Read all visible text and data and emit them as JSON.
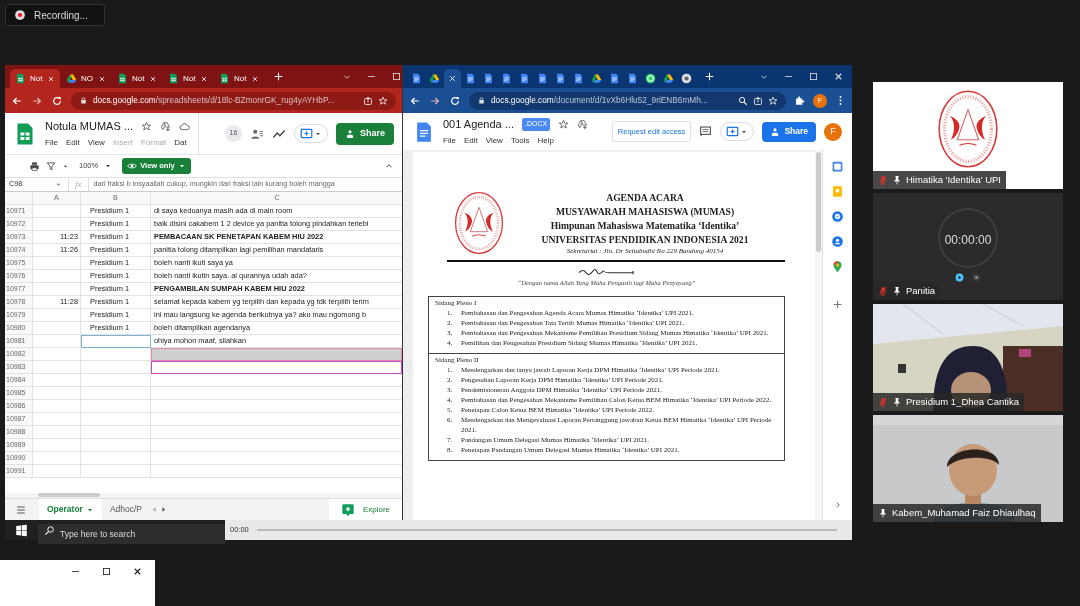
{
  "recording": {
    "label": "Recording..."
  },
  "sheets_window": {
    "tabs": [
      {
        "label": "Not",
        "selected": true
      },
      {
        "label": "NO",
        "selected": false
      },
      {
        "label": "Not",
        "selected": false
      },
      {
        "label": "Not",
        "selected": false
      },
      {
        "label": "Not",
        "selected": false
      }
    ],
    "url_host": "docs.google.com",
    "url_path": "/spreadsheets/d/18lc-BZmonrGK_rug4yAYHbP...",
    "title": "Notula MUMAS ...",
    "menu": [
      {
        "label": "File",
        "disabled": false
      },
      {
        "label": "Edit",
        "disabled": false
      },
      {
        "label": "View",
        "disabled": false
      },
      {
        "label": "Insert",
        "disabled": true
      },
      {
        "label": "Format",
        "disabled": true
      },
      {
        "label": "Dat",
        "disabled": false
      }
    ],
    "viewers": "16",
    "share": "Share",
    "zoom": "100%",
    "view_mode": "View only",
    "cell_ref": "C98",
    "formula_label": "fx",
    "formula": "dari fraksi b insyaallah cukup, mungkin dari fraksi lain kurang boleh mangga",
    "columns": [
      "A",
      "B",
      "C"
    ],
    "rows": [
      {
        "num": "10971",
        "b": "Presidium 1",
        "c": "di saya keduanya masih ada di main room",
        "bold": false,
        "b_selected": false,
        "c_shaded": false,
        "c_outlined": false
      },
      {
        "num": "10972",
        "b": "Presidium 1",
        "c": "baik disini cakabem 1 2 device ya panitia tolong pindahkan terlebi",
        "bold": false,
        "b_selected": false,
        "c_shaded": false,
        "c_outlined": false
      },
      {
        "num": "10973",
        "a": "11:23",
        "b": "Presidium 1",
        "c": "PEMBACAAN SK PENETAPAN KABEM HIU 2022",
        "bold": true,
        "b_selected": false,
        "c_shaded": false,
        "c_outlined": false
      },
      {
        "num": "10974",
        "a": "11:26",
        "b": "Presidium 1",
        "c": "panitia tolong ditampilkan lagi pemilihan mandataris",
        "bold": false,
        "b_selected": false,
        "c_shaded": false,
        "c_outlined": false
      },
      {
        "num": "10975",
        "b": "Presidium 1",
        "c": "boleh nanti ikuti saya ya",
        "bold": false,
        "b_selected": false,
        "c_shaded": false,
        "c_outlined": false
      },
      {
        "num": "10976",
        "b": "Presidium 1",
        "c": "boleh nanti ikutin saya. al qurannya udah ada?",
        "bold": false,
        "b_selected": false,
        "c_shaded": false,
        "c_outlined": false
      },
      {
        "num": "10977",
        "b": "Presidium 1",
        "c": "PENGAMBILAN SUMPAH KABEM HIU 2022",
        "bold": true,
        "b_selected": false,
        "c_shaded": false,
        "c_outlined": false
      },
      {
        "num": "10978",
        "a": "11:28",
        "b": "Presidium 1",
        "c": "selamat kepada kabem yg terpilih dan kepada yg tdk terpilih terim",
        "bold": false,
        "b_selected": false,
        "c_shaded": false,
        "c_outlined": false
      },
      {
        "num": "10979",
        "b": "Presidium 1",
        "c": "ini mau langsung ke agenda berikutnya ya?  aku mau ngomong b",
        "bold": false,
        "b_selected": false,
        "c_shaded": false,
        "c_outlined": false
      },
      {
        "num": "10980",
        "b": "Presidium 1",
        "c": "boleh ditampilkan agendanya",
        "bold": false,
        "b_selected": false,
        "c_shaded": false,
        "c_outlined": false
      },
      {
        "num": "10981",
        "c": "ohiya mohon maaf, silahkan",
        "bold": false,
        "b_selected": true,
        "c_shaded": false,
        "c_outlined": false
      },
      {
        "num": "10982",
        "b_selected": false,
        "c_shaded": true,
        "c_outlined": false
      },
      {
        "num": "10983",
        "b_selected": false,
        "c_shaded": false,
        "c_outlined": true
      },
      {
        "num": "10984",
        "b_selected": false,
        "c_shaded": false,
        "c_outlined": false
      },
      {
        "num": "10985",
        "b_selected": false,
        "c_shaded": false,
        "c_outlined": false
      },
      {
        "num": "10986",
        "b_selected": false,
        "c_shaded": false,
        "c_outlined": false
      },
      {
        "num": "10987",
        "b_selected": false,
        "c_shaded": false,
        "c_outlined": false
      },
      {
        "num": "10988",
        "b_selected": false,
        "c_shaded": false,
        "c_outlined": false
      },
      {
        "num": "10989",
        "b_selected": false,
        "c_shaded": false,
        "c_outlined": false
      },
      {
        "num": "10990",
        "b_selected": false,
        "c_shaded": false,
        "c_outlined": false
      },
      {
        "num": "10991",
        "b_selected": false,
        "c_shaded": false,
        "c_outlined": false
      }
    ],
    "sheet_tabs": [
      {
        "label": "Operator",
        "selected": true
      },
      {
        "label": "Adhoc/P",
        "selected": false
      }
    ],
    "explore": "Explore"
  },
  "docs_window": {
    "tabs": [
      {
        "selected": false
      },
      {
        "selected": false
      },
      {
        "selected": true
      },
      {
        "selected": false
      },
      {
        "selected": false
      },
      {
        "selected": false
      },
      {
        "selected": false
      },
      {
        "selected": false
      },
      {
        "selected": false
      },
      {
        "selected": false
      },
      {
        "selected": false
      },
      {
        "selected": false
      },
      {
        "selected": false
      },
      {
        "selected": false
      },
      {
        "selected": false
      },
      {
        "selected": false
      }
    ],
    "url_host": "docs.google.com",
    "url_path": "/document/d/1vXb6Hlu52_9riENB6mMh...",
    "profile": "F",
    "title": "001 Agenda ...",
    "format": ".DOCX",
    "menu": [
      "File",
      "Edit",
      "View",
      "Tools",
      "Help"
    ],
    "request_access": "Request edit access",
    "share": "Share",
    "avatar": "F",
    "document": {
      "heading": [
        "AGENDA ACARA",
        "MUSYAWARAH MAHASISWA (MUMAS)",
        "Himpunan Mahasiswa Matematika ‘Identika’",
        "UNIVERSITAS PENDIDIKAN INDONESIA 2021"
      ],
      "address": "Sekretariat : Jln. Dr Setiabudhi No 229 Bandung 40154",
      "motto": "“Dengan nama Allah Yang Maha Pengasih lagi Maha Penyayang”",
      "sections": [
        {
          "title": "Sidang Pleno I",
          "items": [
            {
              "num": "1.",
              "text": "Pembahasan dan Pengesahan Agenda Acara Mumas Himatika ‘Identika’ UPI 2021."
            },
            {
              "num": "2.",
              "text": "Pembahasan dan Pengesahan Tata Tertib Mumas Himatika ‘Identika’ UPI 2021."
            },
            {
              "num": "3.",
              "text": "Pembahasan dan Pengesahan Mekanisme Pemilihan Presidium Sidang Mumas Himatika ‘Identika’ UPI 2021."
            },
            {
              "num": "4.",
              "text": "Pemilihan dan Pengesahan Presidium Sidang Mumas Himatika ‘Identika’ UPI 2021."
            }
          ]
        },
        {
          "title": "Sidang Pleno II",
          "items": [
            {
              "num": "1.",
              "text": "Mendengarkan dan tanya jawab Laporan Kerja DPM Himatika ‘Identika’ UPI Periode 2021."
            },
            {
              "num": "2.",
              "text": "Pengesahan Laporan Kerja DPM Himatika ‘Identika’ UPI Periode 2021."
            },
            {
              "num": "3.",
              "text": "Pendemisioneran Anggota DPM Himatika ‘Identika’ UPI Periode 2021."
            },
            {
              "num": "4.",
              "text": "Pembahasan dan Pengesahan Mekanisme Pemilihan Calon Ketua BEM Himatika ‘Identika’ UPI Periode 2022."
            },
            {
              "num": "5.",
              "text": "Penetapan Calon Ketua BEM Himatika ‘Identika’ UPI Periode 2022."
            },
            {
              "num": "6.",
              "text": "Mendengarkan dan Mengevaluasi Laporan Pertanggung jawaban Ketua BEM Himatika ‘Identika’ UPI Periode 2021."
            },
            {
              "num": "7.",
              "text": "Pandangan Umum Delegasi Mumas Himatika ‘Identika’ UPI 2021."
            },
            {
              "num": "8.",
              "text": "Penetapan Pandangan Umum Delegasi Mumas Himatika ‘Identika’ UPI 2021."
            }
          ]
        }
      ]
    }
  },
  "taskbar": {
    "search_placeholder": "Type here to search",
    "media_time": "00:00"
  },
  "participants": [
    {
      "name": "Himatika 'Identika' UPI",
      "kind": "logo",
      "muted": true
    },
    {
      "name": "Panitia",
      "kind": "timer",
      "timer": "00:00:00",
      "muted": true
    },
    {
      "name": "Presidium 1_Dhea Cantika",
      "kind": "video",
      "muted": true
    },
    {
      "name": "Kabem_Muhamad Faiz Dhiaulhaq",
      "kind": "video",
      "muted": false
    }
  ]
}
